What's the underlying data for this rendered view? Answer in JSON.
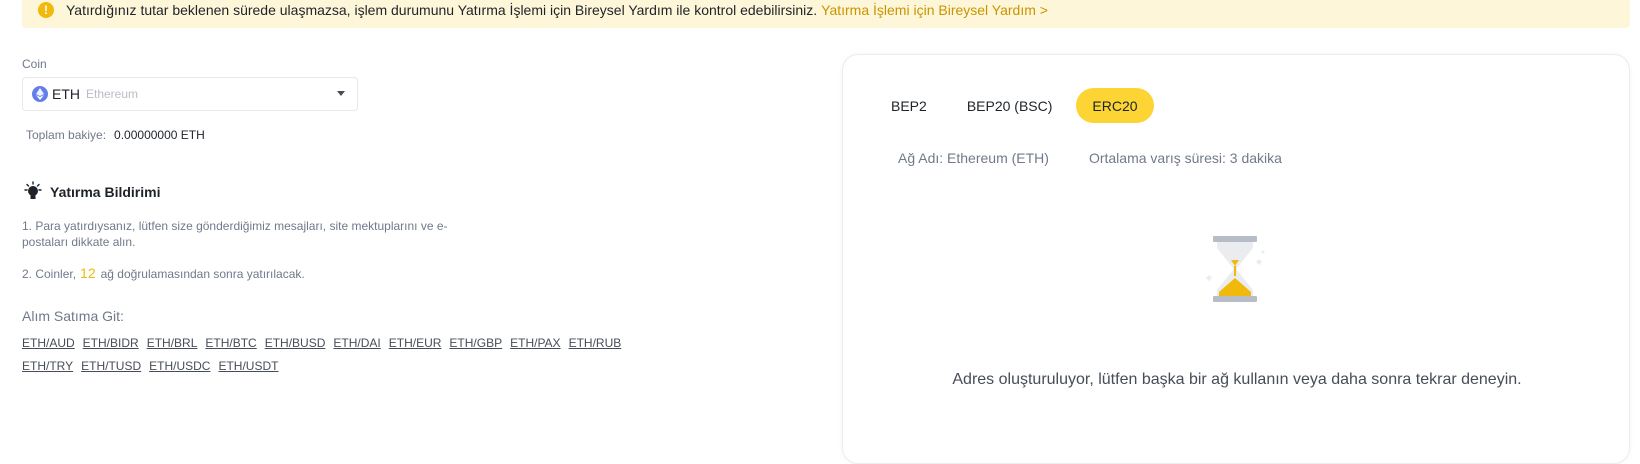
{
  "banner": {
    "text": "Yatırdığınız tutar beklenen sürede ulaşmazsa, işlem durumunu Yatırma İşlemi için Bireysel Yardım ile kontrol edebilirsiniz.",
    "link": "Yatırma İşlemi için Bireysel Yardım >"
  },
  "coin": {
    "label": "Coin",
    "symbol": "ETH",
    "name": "Ethereum",
    "icon": "ethereum-icon"
  },
  "balance": {
    "label": "Toplam bakiye:",
    "value": "0.00000000 ETH"
  },
  "notice": {
    "title": "Yatırma Bildirimi",
    "item1": "1. Para yatırdıysanız, lütfen size gönderdiğimiz mesajları, site mektuplarını ve e-postaları dikkate alın.",
    "item2_prefix": "2. Coinler,",
    "item2_number": "12",
    "item2_suffix": "ağ doğrulamasından sonra yatırılacak."
  },
  "trade": {
    "label": "Alım Satıma Git:",
    "pairs": [
      "ETH/AUD",
      "ETH/BIDR",
      "ETH/BRL",
      "ETH/BTC",
      "ETH/BUSD",
      "ETH/DAI",
      "ETH/EUR",
      "ETH/GBP",
      "ETH/PAX",
      "ETH/RUB",
      "ETH/TRY",
      "ETH/TUSD",
      "ETH/USDC",
      "ETH/USDT"
    ]
  },
  "networks": {
    "tabs": [
      "BEP2",
      "BEP20 (BSC)",
      "ERC20"
    ],
    "active": "ERC20",
    "network_name": "Ağ Adı: Ethereum (ETH)",
    "arrival_time": "Ortalama varış süresi: 3 dakika",
    "message": "Adres oluşturuluyor, lütfen başka bir ağ kullanın veya daha sonra tekrar deneyin."
  },
  "colors": {
    "accent": "#fcd535",
    "link": "#c99400",
    "banner_bg": "#fef6d8"
  }
}
